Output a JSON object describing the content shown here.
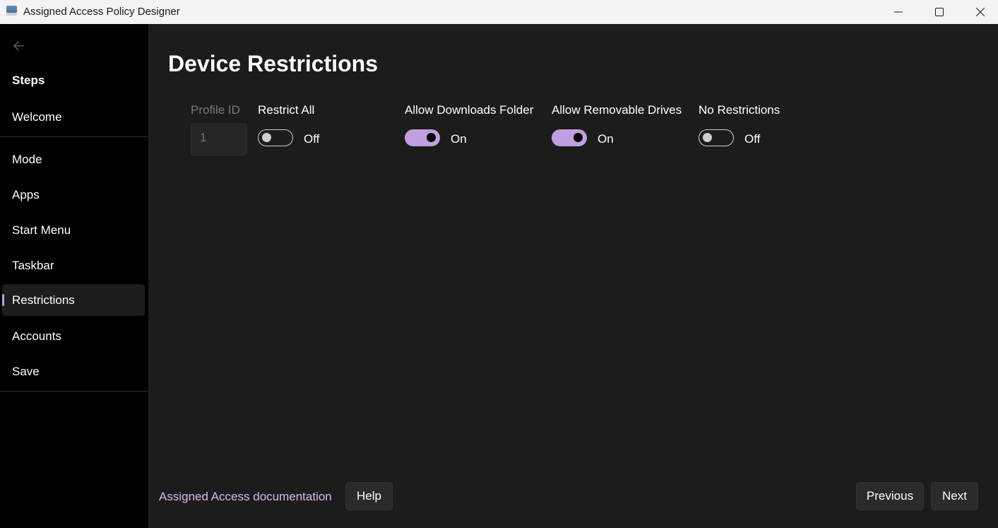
{
  "window": {
    "title": "Assigned Access Policy Designer"
  },
  "sidebar": {
    "heading": "Steps",
    "items": [
      {
        "label": "Welcome"
      },
      {
        "label": "Mode"
      },
      {
        "label": "Apps"
      },
      {
        "label": "Start Menu"
      },
      {
        "label": "Taskbar"
      },
      {
        "label": "Restrictions"
      },
      {
        "label": "Accounts"
      },
      {
        "label": "Save"
      }
    ],
    "selected": "Restrictions"
  },
  "main": {
    "title": "Device Restrictions",
    "profile": {
      "label": "Profile ID",
      "value": "1"
    },
    "toggles": [
      {
        "label": "Restrict All",
        "state": "Off"
      },
      {
        "label": "Allow Downloads Folder",
        "state": "On"
      },
      {
        "label": "Allow Removable Drives",
        "state": "On"
      },
      {
        "label": "No Restrictions",
        "state": "Off"
      }
    ]
  },
  "footer": {
    "doc_link": "Assigned Access documentation",
    "help": "Help",
    "previous": "Previous",
    "next": "Next"
  },
  "colors": {
    "accent": "#c29ee0",
    "link": "#d8b8f3",
    "sidebar_bg": "#000000",
    "content_bg": "#1c1c1c"
  }
}
